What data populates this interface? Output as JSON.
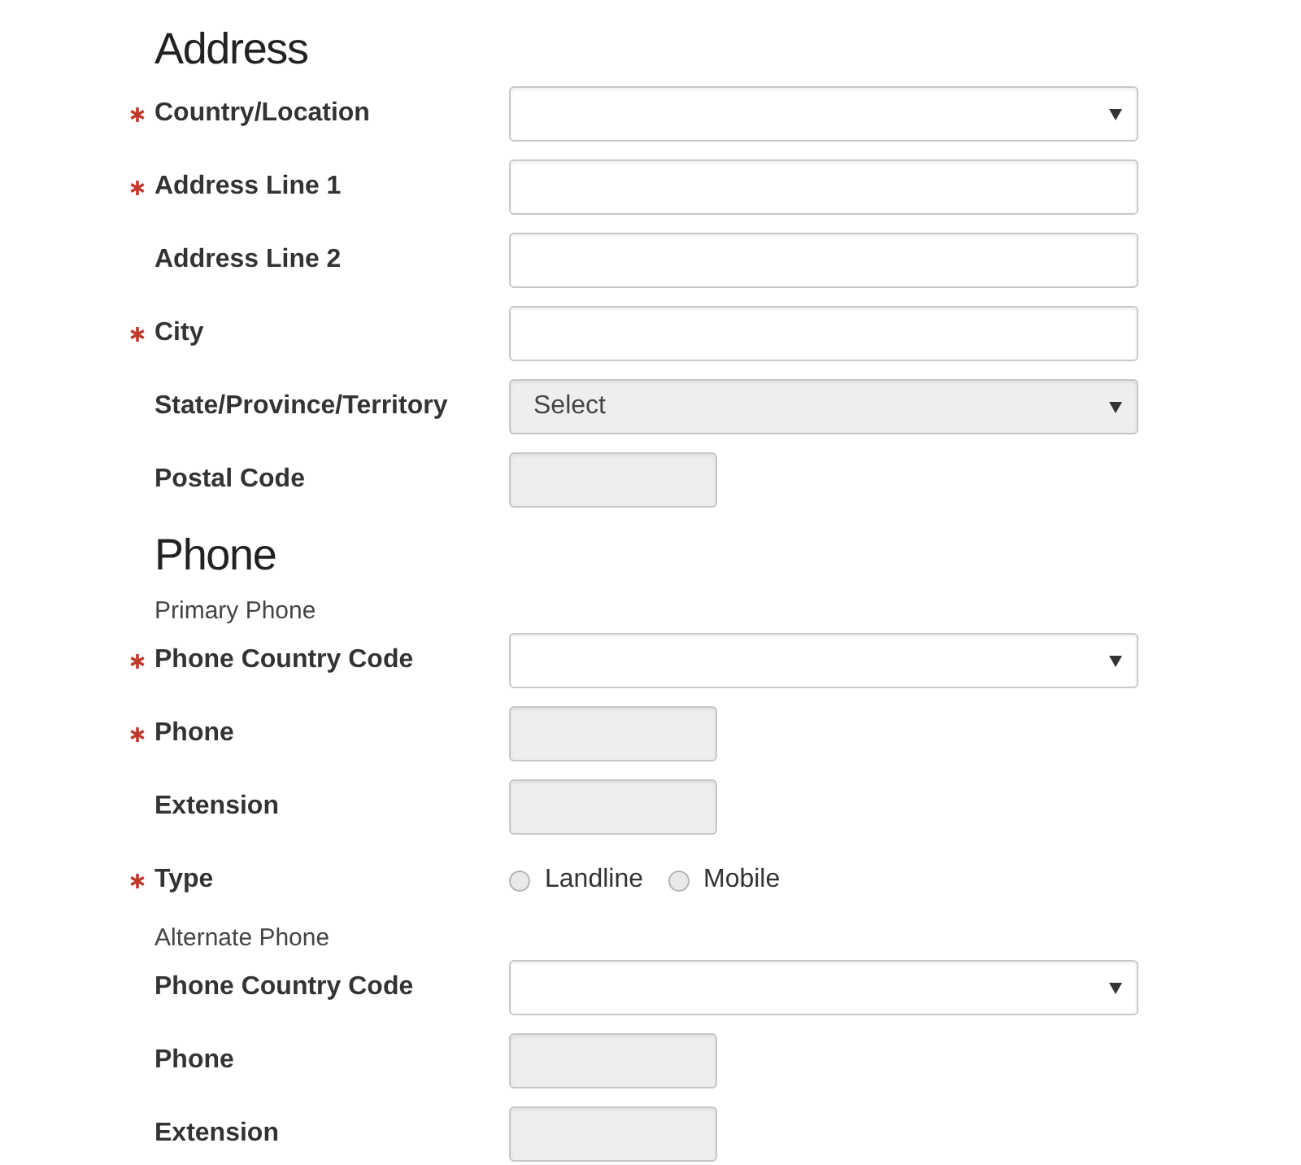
{
  "sections": [
    {
      "title": "Address",
      "items": [
        {
          "kind": "field",
          "label": "Country/Location",
          "required": true,
          "control": {
            "kind": "select",
            "disabled": false
          }
        },
        {
          "kind": "field",
          "label": "Address Line 1",
          "required": true,
          "control": {
            "kind": "text",
            "disabled": false
          }
        },
        {
          "kind": "field",
          "label": "Address Line 2",
          "required": false,
          "control": {
            "kind": "text",
            "disabled": false
          }
        },
        {
          "kind": "field",
          "label": "City",
          "required": true,
          "control": {
            "kind": "text",
            "disabled": false
          }
        },
        {
          "kind": "field",
          "label": "State/Province/Territory",
          "required": false,
          "control": {
            "kind": "select",
            "disabled": true,
            "value": "Select"
          }
        },
        {
          "kind": "field",
          "label": "Postal Code",
          "required": false,
          "control": {
            "kind": "short-text",
            "disabled": true
          }
        }
      ]
    },
    {
      "title": "Phone",
      "items": [
        {
          "kind": "subheading",
          "label": "Primary Phone"
        },
        {
          "kind": "field",
          "label": "Phone Country Code",
          "required": true,
          "control": {
            "kind": "select",
            "disabled": false
          }
        },
        {
          "kind": "field",
          "label": "Phone",
          "required": true,
          "control": {
            "kind": "short-text",
            "disabled": true
          }
        },
        {
          "kind": "field",
          "label": "Extension",
          "required": false,
          "control": {
            "kind": "short-text",
            "disabled": true
          }
        },
        {
          "kind": "field",
          "label": "Type",
          "required": true,
          "control": {
            "kind": "radio",
            "options": [
              {
                "label": "Landline",
                "selected": false
              },
              {
                "label": "Mobile",
                "selected": false
              }
            ]
          }
        },
        {
          "kind": "subheading",
          "label": "Alternate Phone"
        },
        {
          "kind": "field",
          "label": "Phone Country Code",
          "required": false,
          "control": {
            "kind": "select",
            "disabled": false
          }
        },
        {
          "kind": "field",
          "label": "Phone",
          "required": false,
          "control": {
            "kind": "short-text",
            "disabled": true
          }
        },
        {
          "kind": "field",
          "label": "Extension",
          "required": false,
          "control": {
            "kind": "short-text",
            "disabled": true
          }
        }
      ]
    }
  ]
}
